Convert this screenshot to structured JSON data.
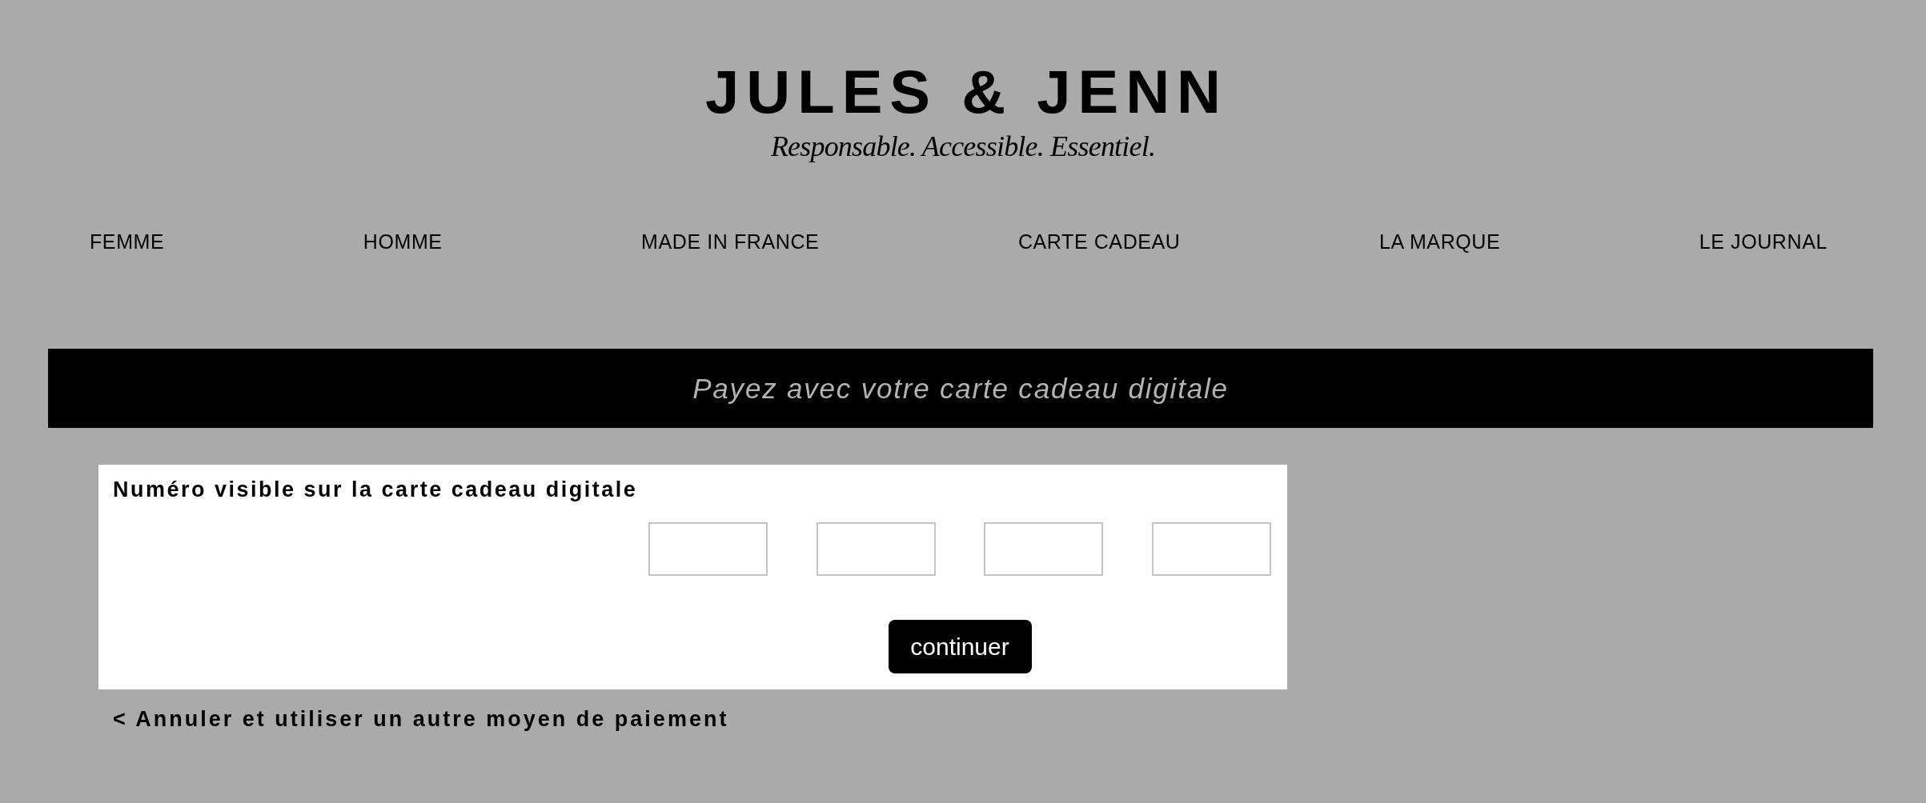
{
  "header": {
    "wordmark": "JULES & JENN",
    "tagline": "Responsable. Accessible. Essentiel."
  },
  "nav": [
    "FEMME",
    "HOMME",
    "MADE IN FRANCE",
    "CARTE CADEAU",
    "LA MARQUE",
    "LE JOURNAL"
  ],
  "banner": {
    "title": "Payez avec votre carte cadeau digitale"
  },
  "gift_card_form": {
    "label": "Numéro visible sur la carte cadeau digitale",
    "code_fields": [
      {
        "kind": "text"
      },
      {
        "kind": "text"
      },
      {
        "kind": "text"
      },
      {
        "kind": "text"
      }
    ],
    "button": "continuer"
  },
  "back_link": "< Annuler et utiliser un autre moyen de paiement"
}
